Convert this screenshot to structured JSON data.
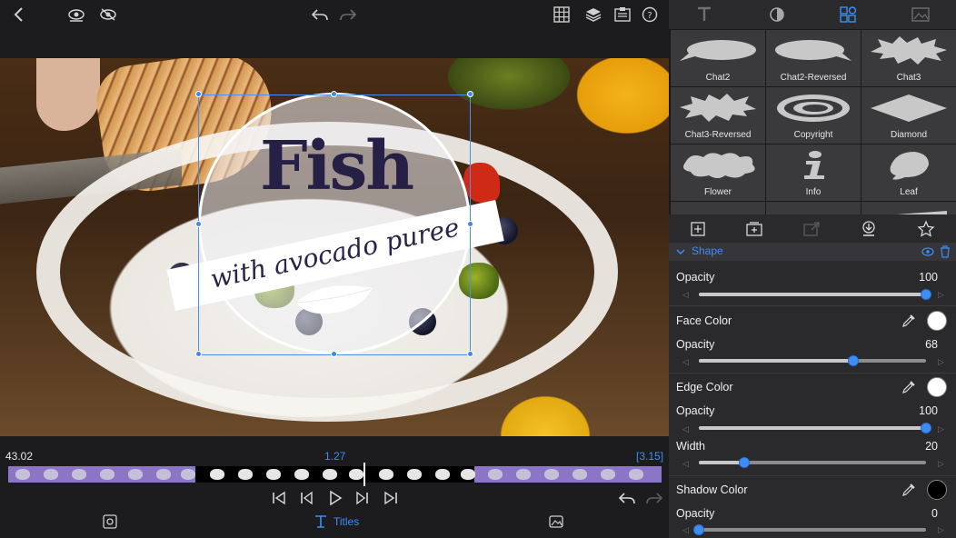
{
  "video": {
    "title_main": "Fish",
    "title_sub": "with avocado puree"
  },
  "timeline": {
    "time_left": "43.02",
    "time_current": "1.27",
    "time_duration": "[3.15]"
  },
  "bottom_bar": {
    "titles_label": "Titles"
  },
  "shape_library": {
    "items": [
      {
        "label": "Chat2"
      },
      {
        "label": "Chat2-Reversed"
      },
      {
        "label": "Chat3"
      },
      {
        "label": "Chat3-Reversed"
      },
      {
        "label": "Copyright"
      },
      {
        "label": "Diamond"
      },
      {
        "label": "Flower"
      },
      {
        "label": "Info"
      },
      {
        "label": "Leaf"
      }
    ]
  },
  "inspector": {
    "section_title": "Shape",
    "opacity_label": "Opacity",
    "opacity_value": "100",
    "face_color_label": "Face Color",
    "face_opacity_label": "Opacity",
    "face_opacity_value": "68",
    "edge_color_label": "Edge Color",
    "edge_opacity_label": "Opacity",
    "edge_opacity_value": "100",
    "width_label": "Width",
    "width_value": "20",
    "shadow_color_label": "Shadow Color",
    "shadow_opacity_label": "Opacity",
    "shadow_opacity_value": "0",
    "levels": {
      "opacity": 1.0,
      "face_opacity": 0.68,
      "edge_opacity": 1.0,
      "width": 0.2,
      "shadow_opacity": 0.0
    },
    "colors": {
      "face_color": "#ffffff",
      "edge_color": "#ffffff",
      "shadow_color": "#000000",
      "accent": "#3d8ef4"
    }
  }
}
